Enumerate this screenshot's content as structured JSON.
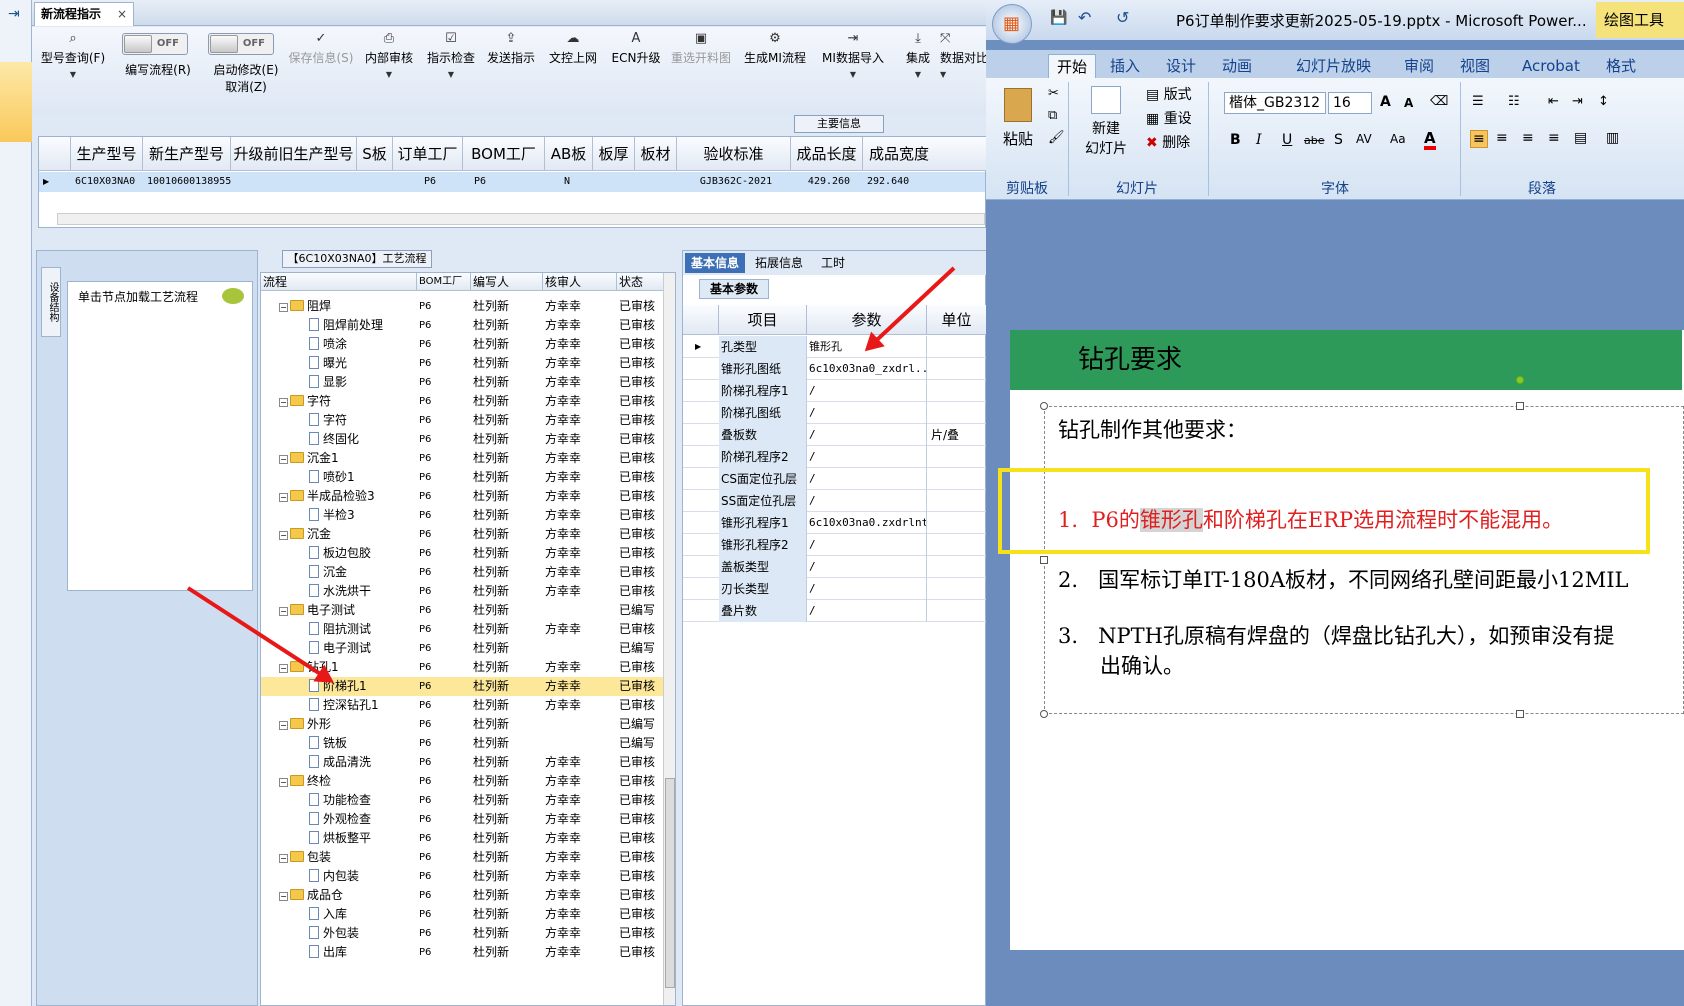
{
  "erp": {
    "tab_title": "新流程指示",
    "tab_close": "×",
    "toolbar": [
      {
        "label": "型号查询(F)",
        "icon": "search-icon",
        "disabled": false
      },
      {
        "label": "编写流程(R)",
        "icon": "toggle",
        "disabled": false
      },
      {
        "label": "启动修改(E)",
        "sub": "取消(Z)",
        "icon": "toggle",
        "disabled": false
      },
      {
        "label": "保存信息(S)",
        "icon": "check-icon",
        "disabled": true
      },
      {
        "label": "内部审核",
        "icon": "print-icon",
        "disabled": false
      },
      {
        "label": "指示检查",
        "icon": "checklist-icon",
        "disabled": false
      },
      {
        "label": "发送指示",
        "icon": "upload-icon",
        "disabled": false
      },
      {
        "label": "文控上网",
        "icon": "cloud-upload-icon",
        "disabled": false
      },
      {
        "label": "ECN升级",
        "icon": "ecn-icon",
        "disabled": false
      },
      {
        "label": "重选开料图",
        "icon": "image-icon",
        "disabled": true
      },
      {
        "label": "生成MI流程",
        "icon": "gears-icon",
        "disabled": false
      },
      {
        "label": "MI数据导入",
        "icon": "import-icon",
        "disabled": false
      },
      {
        "label": "集成",
        "icon": "download-icon",
        "disabled": false
      },
      {
        "label": "数据对比",
        "icon": "compare-icon",
        "disabled": false
      }
    ],
    "toggle_off": "OFF",
    "main_info_label": "主要信息",
    "grid_headers": [
      "生产型号",
      "新生产型号",
      "升级前旧生产型号",
      "S板",
      "订单工厂",
      "BOM工厂",
      "AB板",
      "板厚",
      "板材",
      "验收标准",
      "成品长度",
      "成品宽度"
    ],
    "grid_row": [
      "6C10X03NA0",
      "10010600138955",
      "",
      "",
      "P6",
      "P6",
      "N",
      "",
      "",
      "GJB362C-2021",
      "429.260",
      "292.640"
    ],
    "flow_title": "【6C10X03NA0】工艺流程",
    "side_tab": "设备结构",
    "click_hint": "单击节点加载工艺流程",
    "tree_headers": [
      "流程",
      "BOM工厂",
      "编写人",
      "核审人",
      "状态"
    ],
    "tree_rows": [
      {
        "level": 0,
        "type": "folder",
        "name": "阻焊",
        "bom": "P6",
        "writer": "杜列新",
        "reviewer": "方幸幸",
        "status": "已审核"
      },
      {
        "level": 1,
        "type": "doc",
        "name": "阻焊前处理",
        "bom": "P6",
        "writer": "杜列新",
        "reviewer": "方幸幸",
        "status": "已审核"
      },
      {
        "level": 1,
        "type": "doc",
        "name": "喷涂",
        "bom": "P6",
        "writer": "杜列新",
        "reviewer": "方幸幸",
        "status": "已审核"
      },
      {
        "level": 1,
        "type": "doc",
        "name": "曝光",
        "bom": "P6",
        "writer": "杜列新",
        "reviewer": "方幸幸",
        "status": "已审核"
      },
      {
        "level": 1,
        "type": "doc",
        "name": "显影",
        "bom": "P6",
        "writer": "杜列新",
        "reviewer": "方幸幸",
        "status": "已审核"
      },
      {
        "level": 0,
        "type": "folder",
        "name": "字符",
        "bom": "P6",
        "writer": "杜列新",
        "reviewer": "方幸幸",
        "status": "已审核"
      },
      {
        "level": 1,
        "type": "doc",
        "name": "字符",
        "bom": "P6",
        "writer": "杜列新",
        "reviewer": "方幸幸",
        "status": "已审核"
      },
      {
        "level": 1,
        "type": "doc",
        "name": "终固化",
        "bom": "P6",
        "writer": "杜列新",
        "reviewer": "方幸幸",
        "status": "已审核"
      },
      {
        "level": 0,
        "type": "folder",
        "name": "沉金1",
        "bom": "P6",
        "writer": "杜列新",
        "reviewer": "方幸幸",
        "status": "已审核"
      },
      {
        "level": 1,
        "type": "doc",
        "name": "喷砂1",
        "bom": "P6",
        "writer": "杜列新",
        "reviewer": "方幸幸",
        "status": "已审核"
      },
      {
        "level": 0,
        "type": "folder",
        "name": "半成品检验3",
        "bom": "P6",
        "writer": "杜列新",
        "reviewer": "方幸幸",
        "status": "已审核"
      },
      {
        "level": 1,
        "type": "doc",
        "name": "半检3",
        "bom": "P6",
        "writer": "杜列新",
        "reviewer": "方幸幸",
        "status": "已审核"
      },
      {
        "level": 0,
        "type": "folder",
        "name": "沉金",
        "bom": "P6",
        "writer": "杜列新",
        "reviewer": "方幸幸",
        "status": "已审核"
      },
      {
        "level": 1,
        "type": "doc",
        "name": "板边包胶",
        "bom": "P6",
        "writer": "杜列新",
        "reviewer": "方幸幸",
        "status": "已审核"
      },
      {
        "level": 1,
        "type": "doc",
        "name": "沉金",
        "bom": "P6",
        "writer": "杜列新",
        "reviewer": "方幸幸",
        "status": "已审核"
      },
      {
        "level": 1,
        "type": "doc",
        "name": "水洗烘干",
        "bom": "P6",
        "writer": "杜列新",
        "reviewer": "方幸幸",
        "status": "已审核"
      },
      {
        "level": 0,
        "type": "folder",
        "name": "电子测试",
        "bom": "P6",
        "writer": "杜列新",
        "reviewer": "",
        "status": "已编写"
      },
      {
        "level": 1,
        "type": "doc",
        "name": "阻抗测试",
        "bom": "P6",
        "writer": "杜列新",
        "reviewer": "方幸幸",
        "status": "已审核"
      },
      {
        "level": 1,
        "type": "doc",
        "name": "电子测试",
        "bom": "P6",
        "writer": "杜列新",
        "reviewer": "",
        "status": "已编写"
      },
      {
        "level": 0,
        "type": "folder",
        "name": "钻孔1",
        "bom": "P6",
        "writer": "杜列新",
        "reviewer": "方幸幸",
        "status": "已审核"
      },
      {
        "level": 1,
        "type": "doc",
        "name": "阶梯孔1",
        "bom": "P6",
        "writer": "杜列新",
        "reviewer": "方幸幸",
        "status": "已审核",
        "selected": true
      },
      {
        "level": 1,
        "type": "doc",
        "name": "控深钻孔1",
        "bom": "P6",
        "writer": "杜列新",
        "reviewer": "方幸幸",
        "status": "已审核"
      },
      {
        "level": 0,
        "type": "folder",
        "name": "外形",
        "bom": "P6",
        "writer": "杜列新",
        "reviewer": "",
        "status": "已编写"
      },
      {
        "level": 1,
        "type": "doc",
        "name": "铣板",
        "bom": "P6",
        "writer": "杜列新",
        "reviewer": "",
        "status": "已编写"
      },
      {
        "level": 1,
        "type": "doc",
        "name": "成品清洗",
        "bom": "P6",
        "writer": "杜列新",
        "reviewer": "方幸幸",
        "status": "已审核"
      },
      {
        "level": 0,
        "type": "folder",
        "name": "终检",
        "bom": "P6",
        "writer": "杜列新",
        "reviewer": "方幸幸",
        "status": "已审核"
      },
      {
        "level": 1,
        "type": "doc",
        "name": "功能检查",
        "bom": "P6",
        "writer": "杜列新",
        "reviewer": "方幸幸",
        "status": "已审核"
      },
      {
        "level": 1,
        "type": "doc",
        "name": "外观检查",
        "bom": "P6",
        "writer": "杜列新",
        "reviewer": "方幸幸",
        "status": "已审核"
      },
      {
        "level": 1,
        "type": "doc",
        "name": "烘板整平",
        "bom": "P6",
        "writer": "杜列新",
        "reviewer": "方幸幸",
        "status": "已审核"
      },
      {
        "level": 0,
        "type": "folder",
        "name": "包装",
        "bom": "P6",
        "writer": "杜列新",
        "reviewer": "方幸幸",
        "status": "已审核"
      },
      {
        "level": 1,
        "type": "doc",
        "name": "内包装",
        "bom": "P6",
        "writer": "杜列新",
        "reviewer": "方幸幸",
        "status": "已审核"
      },
      {
        "level": 0,
        "type": "folder",
        "name": "成品仓",
        "bom": "P6",
        "writer": "杜列新",
        "reviewer": "方幸幸",
        "status": "已审核"
      },
      {
        "level": 1,
        "type": "doc",
        "name": "入库",
        "bom": "P6",
        "writer": "杜列新",
        "reviewer": "方幸幸",
        "status": "已审核"
      },
      {
        "level": 1,
        "type": "doc",
        "name": "外包装",
        "bom": "P6",
        "writer": "杜列新",
        "reviewer": "方幸幸",
        "status": "已审核"
      },
      {
        "level": 1,
        "type": "doc",
        "name": "出库",
        "bom": "P6",
        "writer": "杜列新",
        "reviewer": "方幸幸",
        "status": "已审核"
      }
    ],
    "right_tabs": [
      "基本信息",
      "拓展信息",
      "工时"
    ],
    "sub_tab": "基本参数",
    "param_headers": [
      "项目",
      "参数",
      "单位"
    ],
    "params": [
      {
        "k": "孔类型",
        "v": "锥形孔",
        "u": ""
      },
      {
        "k": "锥形孔图纸",
        "v": "6c10x03na0_zxdrl...",
        "u": ""
      },
      {
        "k": "阶梯孔程序1",
        "v": "/",
        "u": ""
      },
      {
        "k": "阶梯孔图纸",
        "v": "/",
        "u": ""
      },
      {
        "k": "叠板数",
        "v": "/",
        "u": "片/叠"
      },
      {
        "k": "阶梯孔程序2",
        "v": "/",
        "u": ""
      },
      {
        "k": "CS面定位孔层",
        "v": "/",
        "u": ""
      },
      {
        "k": "SS面定位孔层",
        "v": "/",
        "u": ""
      },
      {
        "k": "锥形孔程序1",
        "v": "6c10x03na0.zxdrlnt",
        "u": ""
      },
      {
        "k": "锥形孔程序2",
        "v": "/",
        "u": ""
      },
      {
        "k": "盖板类型",
        "v": "/",
        "u": ""
      },
      {
        "k": "刃长类型",
        "v": "/",
        "u": ""
      },
      {
        "k": "叠片数",
        "v": "/",
        "u": ""
      }
    ]
  },
  "ppt": {
    "title": "P6订单制作要求更新2025-05-19.pptx - Microsoft Power...",
    "context_tab": "绘图工具",
    "tabs": [
      "开始",
      "插入",
      "设计",
      "动画",
      "幻灯片放映",
      "审阅",
      "视图",
      "Acrobat",
      "格式"
    ],
    "clipboard": {
      "paste": "粘贴",
      "group": "剪贴板"
    },
    "slides": {
      "new_slide_l1": "新建",
      "new_slide_l2": "幻灯片",
      "layout": "版式",
      "reset": "重设",
      "delete": "删除",
      "group": "幻灯片"
    },
    "font": {
      "name": "楷体_GB2312",
      "size": "16",
      "group": "字体"
    },
    "paragraph": {
      "group": "段落"
    },
    "slide_title": "钻孔要求",
    "intro": "钻孔制作其他要求：",
    "items": [
      {
        "num": "1.",
        "pre": "P6的",
        "hl": "锥形孔",
        "post": "和阶梯孔在ERP选用流程时不能混用。"
      },
      {
        "num": "2.",
        "text": "国军标订单IT-180A板材，不同网络孔壁间距最小12MIL"
      },
      {
        "num": "3.",
        "text": "NPTH孔原稿有焊盘的（焊盘比钻孔大），如预审没有提",
        "text2": "出确认。"
      }
    ]
  }
}
